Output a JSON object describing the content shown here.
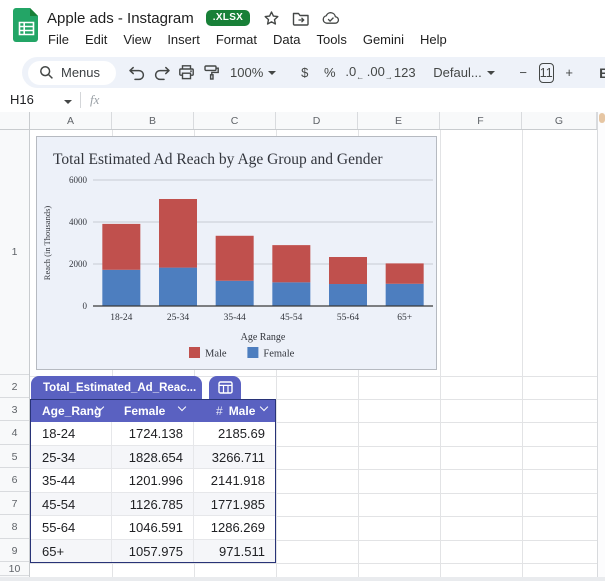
{
  "titlebar": {
    "title": "Apple ads - Instagram",
    "badge": ".XLSX"
  },
  "menubar": {
    "items": [
      "File",
      "Edit",
      "View",
      "Insert",
      "Format",
      "Data",
      "Tools",
      "Gemini",
      "Help"
    ]
  },
  "toolbar": {
    "menus_label": "Menus",
    "zoom_value": "100%",
    "currency_label": "$",
    "percent_label": "%",
    "decrease_decimal_label": ".0",
    "increase_decimal_label": ".00",
    "number_format_label": "123",
    "font_value": "Defaul...",
    "decrease_font_label": "−",
    "font_size_value": "11",
    "increase_font_label": "+",
    "bold_label": "B"
  },
  "formula_bar": {
    "name_box": "H16",
    "fx_label": "fx"
  },
  "grid": {
    "column_headers": [
      "A",
      "B",
      "C",
      "D",
      "E",
      "F",
      "G"
    ],
    "row_headers": [
      "1",
      "2",
      "3",
      "4",
      "5",
      "6",
      "7",
      "8",
      "9",
      "10"
    ]
  },
  "table": {
    "name": "Total_Estimated_Ad_Reac...",
    "columns": [
      {
        "label": "Age_Rang"
      },
      {
        "label": "Female"
      },
      {
        "label": "Male",
        "type_badge": "#"
      }
    ],
    "rows": [
      [
        "18-24",
        "1724.138",
        "2185.69"
      ],
      [
        "25-34",
        "1828.654",
        "3266.711"
      ],
      [
        "35-44",
        "1201.996",
        "2141.918"
      ],
      [
        "45-54",
        "1126.785",
        "1771.985"
      ],
      [
        "55-64",
        "1046.591",
        "1286.269"
      ],
      [
        "65+",
        "1057.975",
        "971.511"
      ]
    ]
  },
  "chart_data": {
    "type": "bar",
    "stacked": true,
    "title": "Total Estimated Ad Reach by Age Group and Gender",
    "categories": [
      "18-24",
      "25-34",
      "35-44",
      "45-54",
      "55-64",
      "65+"
    ],
    "series": [
      {
        "name": "Female",
        "color": "#4d7ebf",
        "values": [
          1724.138,
          1828.654,
          1201.996,
          1126.785,
          1046.591,
          1057.975
        ]
      },
      {
        "name": "Male",
        "color": "#c0504d",
        "values": [
          2185.69,
          3266.711,
          2141.918,
          1771.985,
          1286.269,
          971.511
        ]
      }
    ],
    "legend": [
      {
        "label": "Male",
        "color": "#c0504d"
      },
      {
        "label": "Female",
        "color": "#4d7ebf"
      }
    ],
    "xlabel": "Age Range",
    "ylabel": "Reach (in Thousands)",
    "yticks": [
      0,
      2000,
      4000,
      6000
    ],
    "ylim": [
      0,
      6000
    ],
    "grid": true,
    "legend_position": "bottom",
    "background": "#edf1f9"
  }
}
